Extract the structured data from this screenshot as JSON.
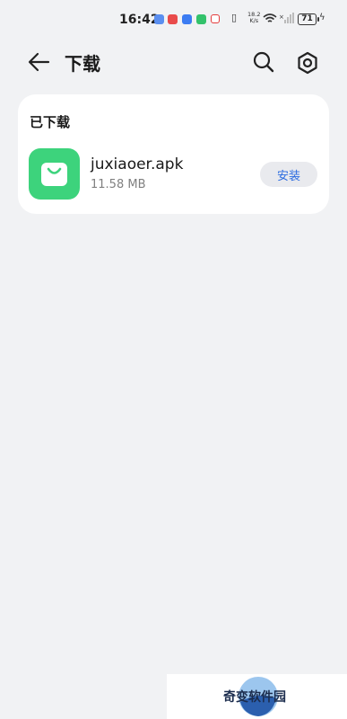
{
  "status_bar": {
    "time": "16:42",
    "network_speed_value": "18.2",
    "network_speed_unit": "K/s",
    "battery_level": "71"
  },
  "header": {
    "title": "下载"
  },
  "downloads": {
    "section_title": "已下载",
    "items": [
      {
        "file_name": "juxiaoer.apk",
        "file_size": "11.58 MB",
        "action_label": "安装"
      }
    ]
  },
  "watermark": {
    "text": "奇变软件园"
  },
  "colors": {
    "background": "#f1f2f4",
    "card": "#ffffff",
    "app_icon": "#3dd37c",
    "accent": "#2a6be0",
    "install_button_bg": "#e9eaee"
  },
  "icons": {
    "back": "arrow-left-icon",
    "search": "search-icon",
    "settings": "gear-icon",
    "app": "shopping-bag-icon"
  }
}
